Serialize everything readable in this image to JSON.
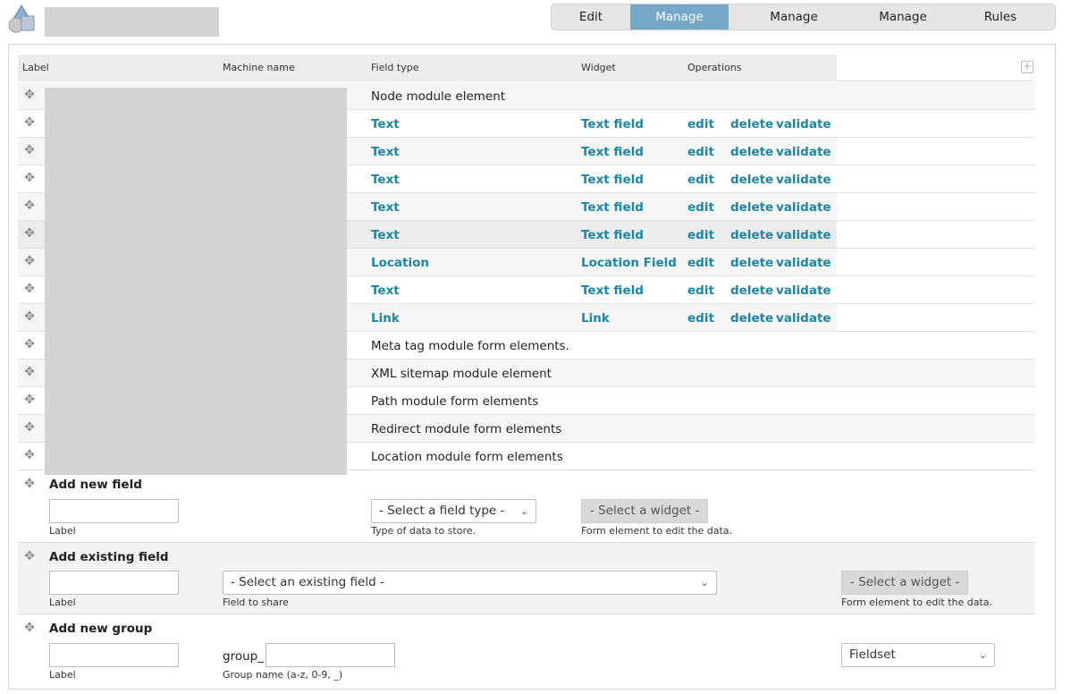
{
  "tabs": [
    {
      "label": "Edit",
      "active": false
    },
    {
      "label": "Manage fields",
      "active": true
    },
    {
      "label": "Manage dependencies",
      "active": false
    },
    {
      "label": "Manage display",
      "active": false
    },
    {
      "label": "Rules",
      "active": false
    }
  ],
  "table": {
    "headers": {
      "label": "Label",
      "machine_name": "Machine name",
      "field_type": "Field type",
      "widget": "Widget",
      "operations": "Operations"
    },
    "rows": [
      {
        "type": "plain",
        "field_type": "Node module element"
      },
      {
        "type": "field",
        "field_type": "Text",
        "widget": "Text field",
        "ops": [
          "edit",
          "delete",
          "validate"
        ]
      },
      {
        "type": "field",
        "field_type": "Text",
        "widget": "Text field",
        "ops": [
          "edit",
          "delete",
          "validate"
        ]
      },
      {
        "type": "field",
        "field_type": "Text",
        "widget": "Text field",
        "ops": [
          "edit",
          "delete",
          "validate"
        ]
      },
      {
        "type": "field",
        "field_type": "Text",
        "widget": "Text field",
        "ops": [
          "edit",
          "delete",
          "validate"
        ]
      },
      {
        "type": "field",
        "field_type": "Text",
        "widget": "Text field",
        "ops": [
          "edit",
          "delete",
          "validate"
        ]
      },
      {
        "type": "field",
        "field_type": "Location",
        "widget": "Location Field",
        "ops": [
          "edit",
          "delete",
          "validate"
        ]
      },
      {
        "type": "field",
        "field_type": "Text",
        "widget": "Text field",
        "ops": [
          "edit",
          "delete",
          "validate"
        ]
      },
      {
        "type": "field",
        "field_type": "Link",
        "widget": "Link",
        "ops": [
          "edit",
          "delete",
          "validate"
        ]
      },
      {
        "type": "plain",
        "field_type": "Meta tag module form elements."
      },
      {
        "type": "plain",
        "field_type": "XML sitemap module element"
      },
      {
        "type": "plain",
        "field_type": "Path module form elements"
      },
      {
        "type": "plain",
        "field_type": "Redirect module form elements"
      },
      {
        "type": "plain",
        "field_type": "Location module form elements"
      }
    ]
  },
  "add_new_field": {
    "title": "Add new field",
    "label_help": "Label",
    "type_select": "- Select a field type -",
    "type_help": "Type of data to store.",
    "widget_button": "- Select a widget -",
    "widget_help": "Form element to edit the data."
  },
  "add_existing_field": {
    "title": "Add existing field",
    "label_help": "Label",
    "field_select": "- Select an existing field -",
    "field_help": "Field to share",
    "widget_button": "- Select a widget -",
    "widget_help": "Form element to edit the data."
  },
  "add_new_group": {
    "title": "Add new group",
    "label_help": "Label",
    "prefix": "group_",
    "name_help": "Group name (a-z, 0-9, _)",
    "format_select": "Fieldset"
  }
}
